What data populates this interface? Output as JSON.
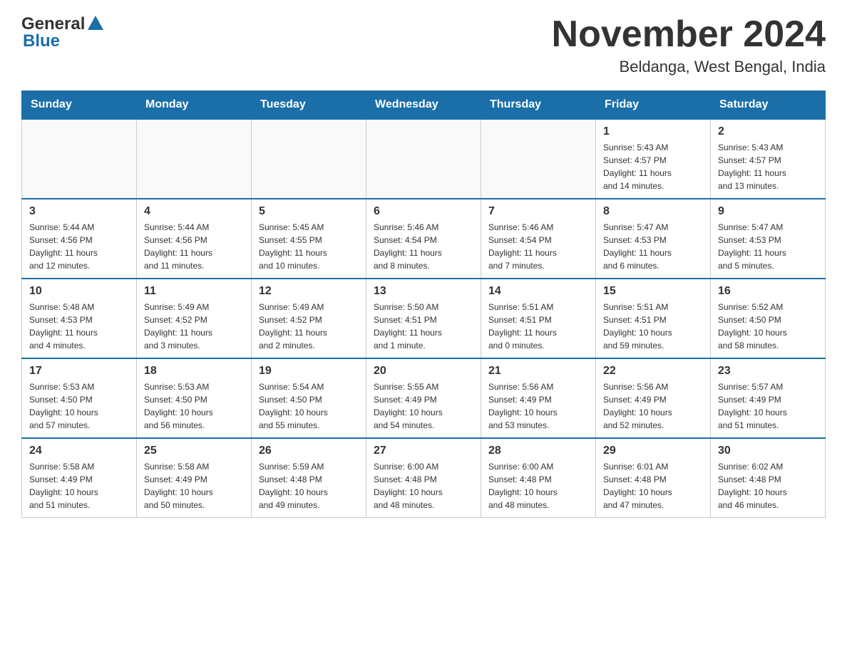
{
  "header": {
    "logo_general": "General",
    "logo_blue": "Blue",
    "month_title": "November 2024",
    "location": "Beldanga, West Bengal, India"
  },
  "days_of_week": [
    "Sunday",
    "Monday",
    "Tuesday",
    "Wednesday",
    "Thursday",
    "Friday",
    "Saturday"
  ],
  "weeks": [
    [
      {
        "day": "",
        "info": ""
      },
      {
        "day": "",
        "info": ""
      },
      {
        "day": "",
        "info": ""
      },
      {
        "day": "",
        "info": ""
      },
      {
        "day": "",
        "info": ""
      },
      {
        "day": "1",
        "info": "Sunrise: 5:43 AM\nSunset: 4:57 PM\nDaylight: 11 hours\nand 14 minutes."
      },
      {
        "day": "2",
        "info": "Sunrise: 5:43 AM\nSunset: 4:57 PM\nDaylight: 11 hours\nand 13 minutes."
      }
    ],
    [
      {
        "day": "3",
        "info": "Sunrise: 5:44 AM\nSunset: 4:56 PM\nDaylight: 11 hours\nand 12 minutes."
      },
      {
        "day": "4",
        "info": "Sunrise: 5:44 AM\nSunset: 4:56 PM\nDaylight: 11 hours\nand 11 minutes."
      },
      {
        "day": "5",
        "info": "Sunrise: 5:45 AM\nSunset: 4:55 PM\nDaylight: 11 hours\nand 10 minutes."
      },
      {
        "day": "6",
        "info": "Sunrise: 5:46 AM\nSunset: 4:54 PM\nDaylight: 11 hours\nand 8 minutes."
      },
      {
        "day": "7",
        "info": "Sunrise: 5:46 AM\nSunset: 4:54 PM\nDaylight: 11 hours\nand 7 minutes."
      },
      {
        "day": "8",
        "info": "Sunrise: 5:47 AM\nSunset: 4:53 PM\nDaylight: 11 hours\nand 6 minutes."
      },
      {
        "day": "9",
        "info": "Sunrise: 5:47 AM\nSunset: 4:53 PM\nDaylight: 11 hours\nand 5 minutes."
      }
    ],
    [
      {
        "day": "10",
        "info": "Sunrise: 5:48 AM\nSunset: 4:53 PM\nDaylight: 11 hours\nand 4 minutes."
      },
      {
        "day": "11",
        "info": "Sunrise: 5:49 AM\nSunset: 4:52 PM\nDaylight: 11 hours\nand 3 minutes."
      },
      {
        "day": "12",
        "info": "Sunrise: 5:49 AM\nSunset: 4:52 PM\nDaylight: 11 hours\nand 2 minutes."
      },
      {
        "day": "13",
        "info": "Sunrise: 5:50 AM\nSunset: 4:51 PM\nDaylight: 11 hours\nand 1 minute."
      },
      {
        "day": "14",
        "info": "Sunrise: 5:51 AM\nSunset: 4:51 PM\nDaylight: 11 hours\nand 0 minutes."
      },
      {
        "day": "15",
        "info": "Sunrise: 5:51 AM\nSunset: 4:51 PM\nDaylight: 10 hours\nand 59 minutes."
      },
      {
        "day": "16",
        "info": "Sunrise: 5:52 AM\nSunset: 4:50 PM\nDaylight: 10 hours\nand 58 minutes."
      }
    ],
    [
      {
        "day": "17",
        "info": "Sunrise: 5:53 AM\nSunset: 4:50 PM\nDaylight: 10 hours\nand 57 minutes."
      },
      {
        "day": "18",
        "info": "Sunrise: 5:53 AM\nSunset: 4:50 PM\nDaylight: 10 hours\nand 56 minutes."
      },
      {
        "day": "19",
        "info": "Sunrise: 5:54 AM\nSunset: 4:50 PM\nDaylight: 10 hours\nand 55 minutes."
      },
      {
        "day": "20",
        "info": "Sunrise: 5:55 AM\nSunset: 4:49 PM\nDaylight: 10 hours\nand 54 minutes."
      },
      {
        "day": "21",
        "info": "Sunrise: 5:56 AM\nSunset: 4:49 PM\nDaylight: 10 hours\nand 53 minutes."
      },
      {
        "day": "22",
        "info": "Sunrise: 5:56 AM\nSunset: 4:49 PM\nDaylight: 10 hours\nand 52 minutes."
      },
      {
        "day": "23",
        "info": "Sunrise: 5:57 AM\nSunset: 4:49 PM\nDaylight: 10 hours\nand 51 minutes."
      }
    ],
    [
      {
        "day": "24",
        "info": "Sunrise: 5:58 AM\nSunset: 4:49 PM\nDaylight: 10 hours\nand 51 minutes."
      },
      {
        "day": "25",
        "info": "Sunrise: 5:58 AM\nSunset: 4:49 PM\nDaylight: 10 hours\nand 50 minutes."
      },
      {
        "day": "26",
        "info": "Sunrise: 5:59 AM\nSunset: 4:48 PM\nDaylight: 10 hours\nand 49 minutes."
      },
      {
        "day": "27",
        "info": "Sunrise: 6:00 AM\nSunset: 4:48 PM\nDaylight: 10 hours\nand 48 minutes."
      },
      {
        "day": "28",
        "info": "Sunrise: 6:00 AM\nSunset: 4:48 PM\nDaylight: 10 hours\nand 48 minutes."
      },
      {
        "day": "29",
        "info": "Sunrise: 6:01 AM\nSunset: 4:48 PM\nDaylight: 10 hours\nand 47 minutes."
      },
      {
        "day": "30",
        "info": "Sunrise: 6:02 AM\nSunset: 4:48 PM\nDaylight: 10 hours\nand 46 minutes."
      }
    ]
  ]
}
